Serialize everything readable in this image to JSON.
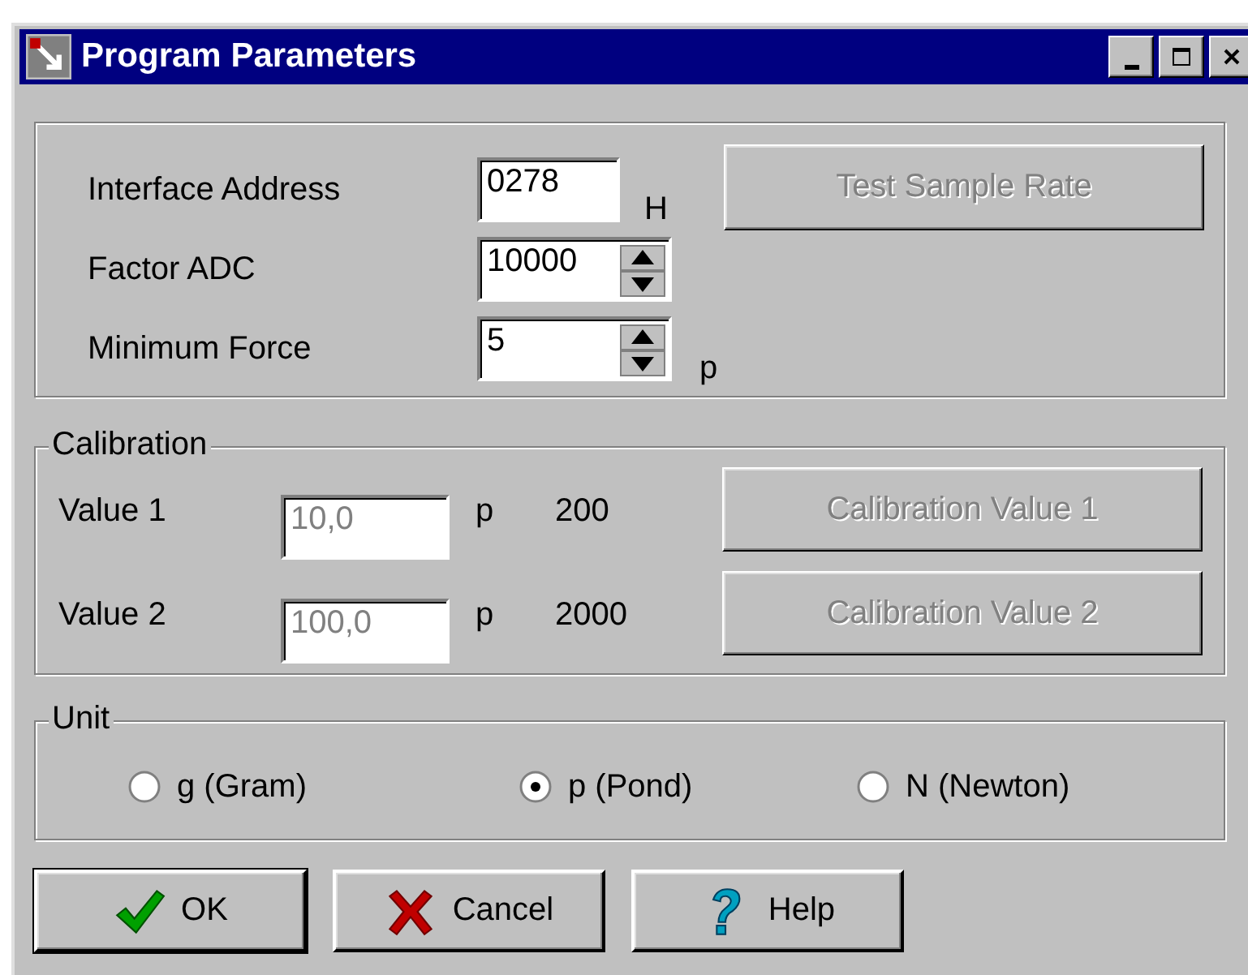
{
  "window": {
    "title": "Program Parameters"
  },
  "settings": [
    {
      "label": "Interface Address",
      "value": "0278",
      "spinner": false,
      "unit": "H"
    },
    {
      "label": "Factor ADC",
      "value": "10000",
      "spinner": true
    },
    {
      "label": "Minimum Force",
      "value": "5",
      "spinner": true,
      "unit": "p"
    }
  ],
  "test_button": {
    "label": "Test Sample Rate",
    "disabled": true
  },
  "calibration": {
    "title": "Calibration",
    "rows": [
      {
        "label": "Value 1",
        "value": "10,0",
        "disabled": true,
        "unit": "p",
        "reading": "200",
        "button": {
          "label": "Calibration Value 1",
          "disabled": true
        }
      },
      {
        "label": "Value 2",
        "value": "100,0",
        "disabled": true,
        "unit": "p",
        "reading": "2000",
        "button": {
          "label": "Calibration Value 2",
          "disabled": true
        }
      }
    ]
  },
  "unit": {
    "title": "Unit",
    "options": [
      {
        "label": "g (Gram)",
        "selected": false
      },
      {
        "label": "p (Pond)",
        "selected": true
      },
      {
        "label": "N (Newton)",
        "selected": false
      }
    ]
  },
  "buttons": [
    {
      "kind": "ok",
      "label": "OK"
    },
    {
      "kind": "cancel",
      "label": "Cancel"
    },
    {
      "kind": "help",
      "label": "Help"
    }
  ]
}
